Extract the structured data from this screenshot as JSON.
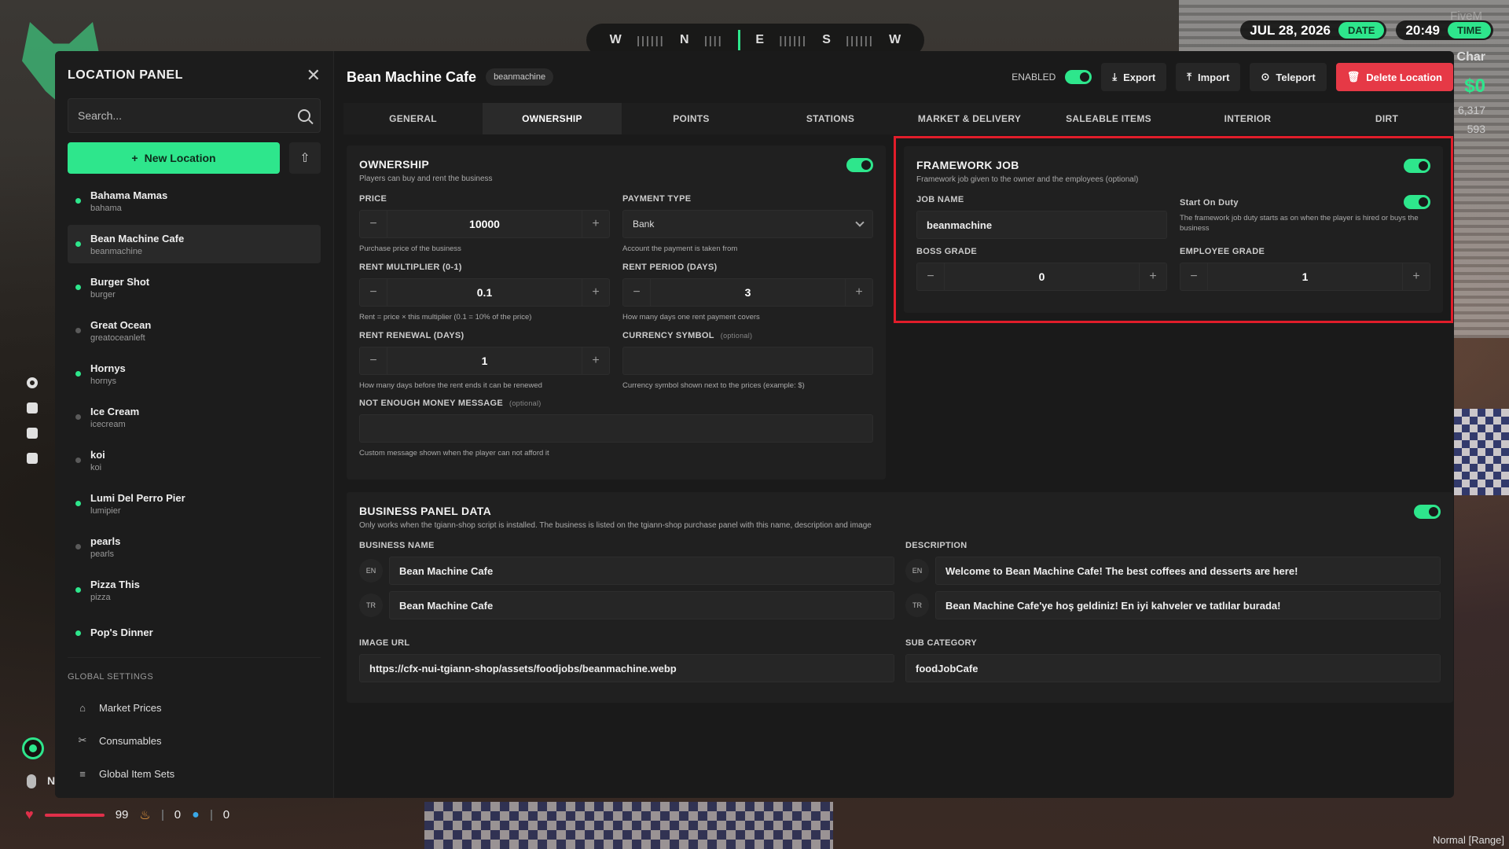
{
  "hud": {
    "compass": {
      "w1": "W",
      "n": "N",
      "e": "E",
      "s": "S",
      "w2": "W"
    },
    "date": "JUL 28, 2026",
    "date_badge": "DATE",
    "time": "20:49",
    "time_badge": "TIME",
    "brand": "FiveM",
    "char_label": "Char",
    "cash": "$0",
    "num1": "6,317",
    "num2": "593",
    "mic_num": "N",
    "health": "99",
    "hunger": "0",
    "thirst": "0",
    "mode": "Normal [Range]",
    "accent": "#2ee68c",
    "danger": "#e63946"
  },
  "sidebar": {
    "title": "LOCATION PANEL",
    "search_placeholder": "Search...",
    "new_location": "New Location",
    "locations": [
      {
        "name": "Bahama Mamas",
        "id": "bahama",
        "enabled": true
      },
      {
        "name": "Bean Machine Cafe",
        "id": "beanmachine",
        "enabled": true,
        "active": true
      },
      {
        "name": "Burger Shot",
        "id": "burger",
        "enabled": true
      },
      {
        "name": "Great Ocean",
        "id": "greatoceanleft",
        "enabled": false
      },
      {
        "name": "Hornys",
        "id": "hornys",
        "enabled": true
      },
      {
        "name": "Ice Cream",
        "id": "icecream",
        "enabled": false
      },
      {
        "name": "koi",
        "id": "koi",
        "enabled": false
      },
      {
        "name": "Lumi Del Perro Pier",
        "id": "lumipier",
        "enabled": true
      },
      {
        "name": "pearls",
        "id": "pearls",
        "enabled": false
      },
      {
        "name": "Pizza This",
        "id": "pizza",
        "enabled": true
      },
      {
        "name": "Pop's Dinner",
        "id": "",
        "enabled": true
      }
    ],
    "global_title": "GLOBAL SETTINGS",
    "global_items": [
      {
        "label": "Market Prices",
        "icon": "shop-icon"
      },
      {
        "label": "Consumables",
        "icon": "utensils-icon"
      },
      {
        "label": "Global Item Sets",
        "icon": "layers-icon"
      }
    ]
  },
  "header": {
    "title": "Bean Machine Cafe",
    "badge": "beanmachine",
    "enabled_label": "ENABLED",
    "export": "Export",
    "import": "Import",
    "teleport": "Teleport",
    "delete": "Delete Location"
  },
  "tabs": [
    "GENERAL",
    "OWNERSHIP",
    "POINTS",
    "STATIONS",
    "MARKET & DELIVERY",
    "SALEABLE ITEMS",
    "INTERIOR",
    "DIRT"
  ],
  "ownership": {
    "title": "OWNERSHIP",
    "sub": "Players can buy and rent the business",
    "price_label": "PRICE",
    "price": "10000",
    "price_hint": "Purchase price of the business",
    "payment_label": "PAYMENT TYPE",
    "payment": "Bank",
    "payment_hint": "Account the payment is taken from",
    "rent_mult_label": "RENT MULTIPLIER (0-1)",
    "rent_mult": "0.1",
    "rent_mult_hint": "Rent = price × this multiplier (0.1 = 10% of the price)",
    "rent_period_label": "RENT PERIOD (DAYS)",
    "rent_period": "3",
    "rent_period_hint": "How many days one rent payment covers",
    "rent_renewal_label": "RENT RENEWAL (DAYS)",
    "rent_renewal": "1",
    "rent_renewal_hint": "How many days before the rent ends it can be renewed",
    "currency_label": "CURRENCY SYMBOL",
    "optional": "(optional)",
    "currency_hint": "Currency symbol shown next to the prices (example: $)",
    "nomoney_label": "NOT ENOUGH MONEY MESSAGE",
    "nomoney_hint": "Custom message shown when the player can not afford it"
  },
  "framework": {
    "title": "FRAMEWORK JOB",
    "sub": "Framework job given to the owner and the employees (optional)",
    "job_label": "JOB NAME",
    "job": "beanmachine",
    "duty_label": "Start On Duty",
    "duty_hint": "The framework job duty starts as on when the player is hired or buys the business",
    "boss_label": "BOSS GRADE",
    "boss": "0",
    "emp_label": "EMPLOYEE GRADE",
    "emp": "1"
  },
  "business": {
    "title": "BUSINESS PANEL DATA",
    "sub": "Only works when the tgiann-shop script is installed. The business is listed on the tgiann-shop purchase panel with this name, description and image",
    "name_label": "BUSINESS NAME",
    "desc_label": "DESCRIPTION",
    "lang_en": "EN",
    "lang_tr": "TR",
    "name_en": "Bean Machine Cafe",
    "name_tr": "Bean Machine Cafe",
    "desc_en": "Welcome to Bean Machine Cafe! The best coffees and desserts are here!",
    "desc_tr": "Bean Machine Cafe'ye hoş geldiniz! En iyi kahveler ve tatlılar burada!",
    "image_label": "IMAGE URL",
    "image": "https://cfx-nui-tgiann-shop/assets/foodjobs/beanmachine.webp",
    "subcat_label": "SUB CATEGORY",
    "subcat": "foodJobCafe"
  }
}
